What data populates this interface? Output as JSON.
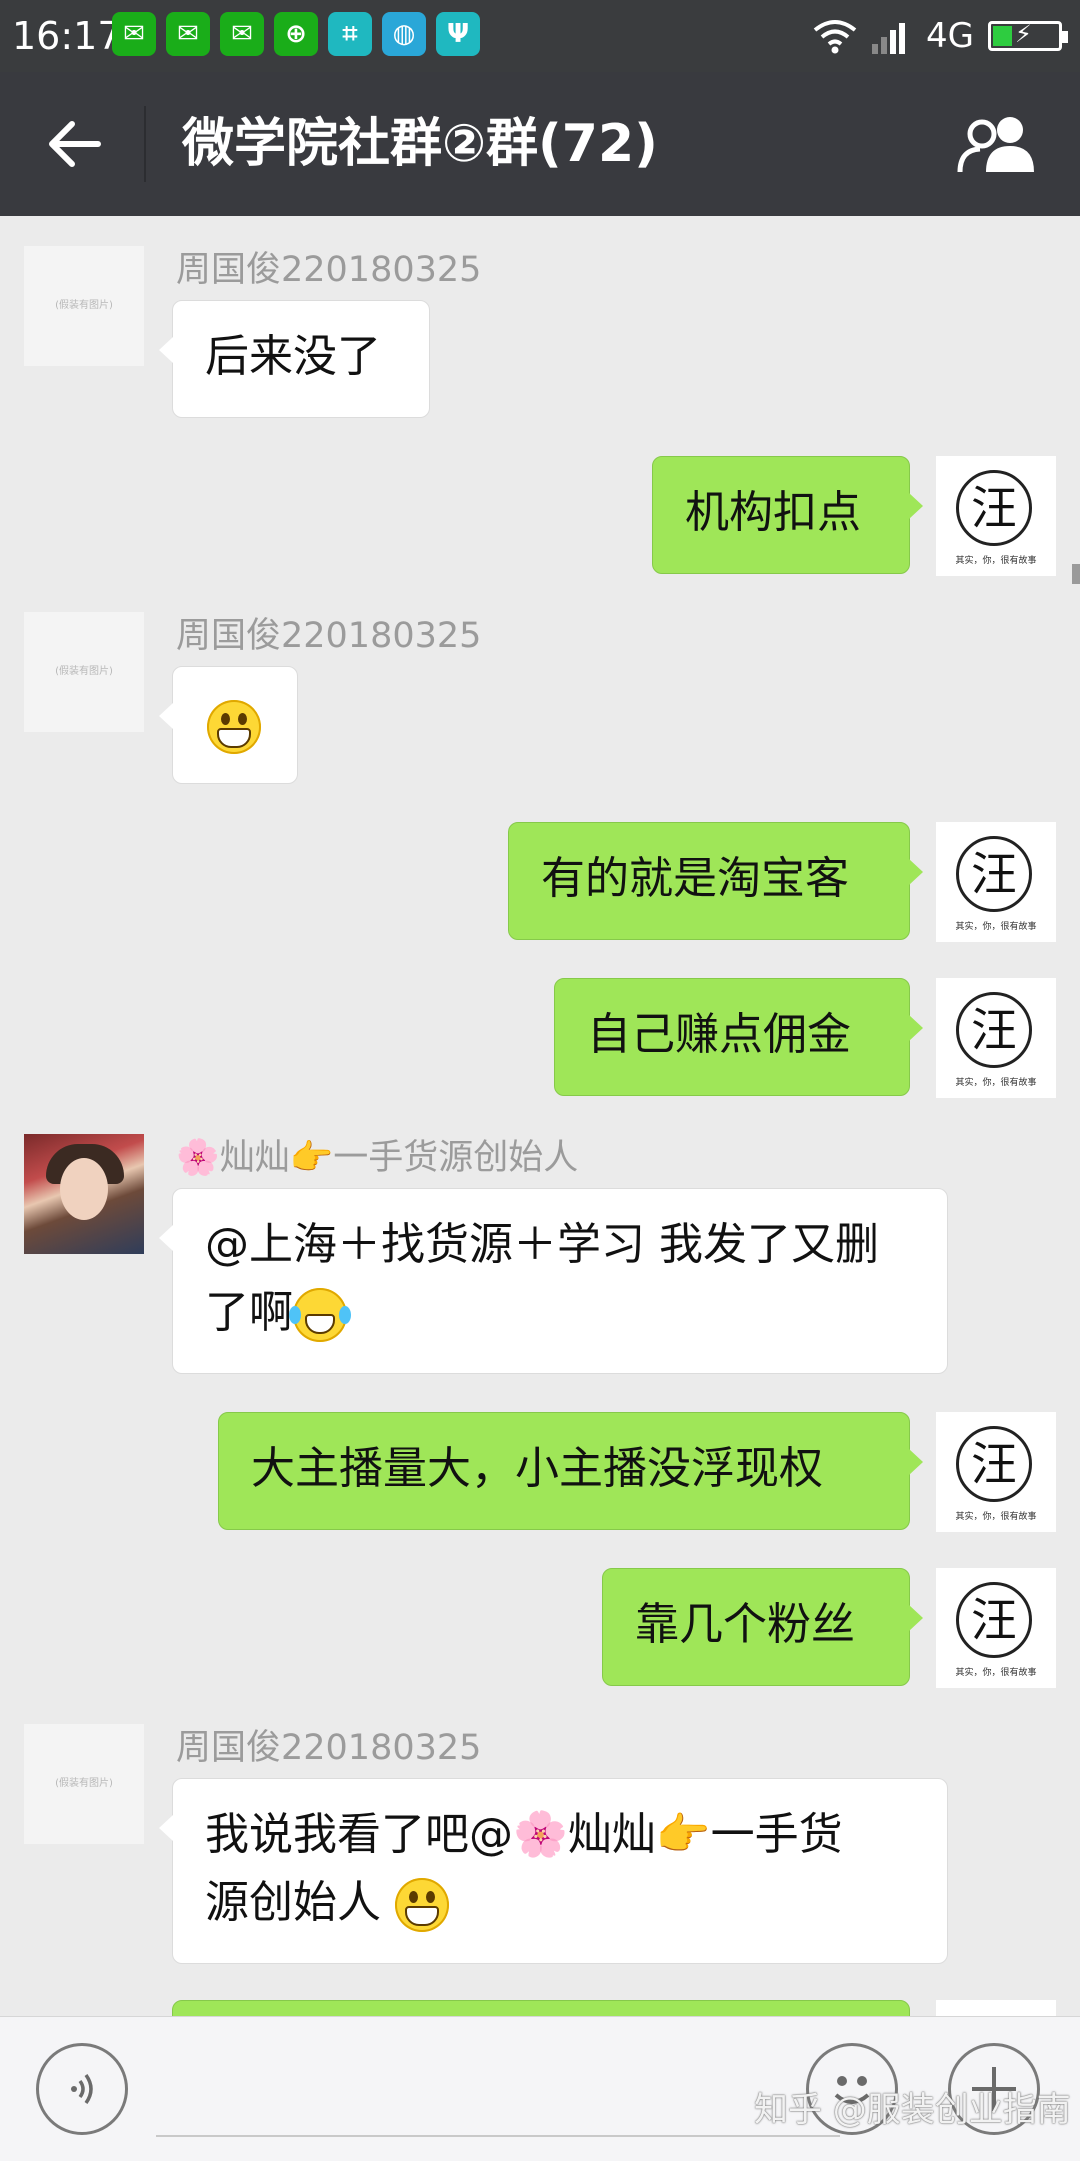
{
  "status_bar": {
    "time": "16:17",
    "network": "4G",
    "battery_level": 0.3,
    "notification_icons": [
      "wechat-icon",
      "wechat-icon",
      "wechat-icon",
      "app-plus-icon",
      "scan-icon",
      "ball-icon",
      "usb-icon"
    ]
  },
  "header": {
    "title": "微学院社群②群(72)"
  },
  "messages": [
    {
      "side": "in",
      "sender": "周国俊220180325",
      "text": "后来没了"
    },
    {
      "side": "out",
      "text": "机构扣点"
    },
    {
      "side": "in",
      "sender": "周国俊220180325",
      "emoji": "grinning-face"
    },
    {
      "side": "out",
      "text": "有的就是淘宝客"
    },
    {
      "side": "out",
      "text": "自己赚点佣金"
    },
    {
      "side": "in",
      "sender_flower": "🌸",
      "sender_main": "灿灿",
      "sender_point": "👉",
      "sender_suffix": "一手货源创始人",
      "text_line1": "@上海＋找货源＋学习  我发了又删",
      "text_line2": "了啊"
    },
    {
      "side": "out",
      "text": "大主播量大，小主播没浮现权"
    },
    {
      "side": "out",
      "text": "靠几个粉丝"
    },
    {
      "side": "in",
      "sender": "周国俊220180325",
      "text_line1_a": "我说我看了吧@",
      "text_line1_flower": "🌸",
      "text_line1_b": "灿灿",
      "text_line1_point": "👉",
      "text_line1_c": "一手货",
      "text_line2": "源创始人"
    }
  ],
  "avatars": {
    "placeholder_text": "(假装有图片)",
    "logo_char": "汪",
    "logo_slogan": "其实，你，很有故事"
  },
  "input_bar": {
    "watermark": "知乎 @服装创业指南"
  }
}
